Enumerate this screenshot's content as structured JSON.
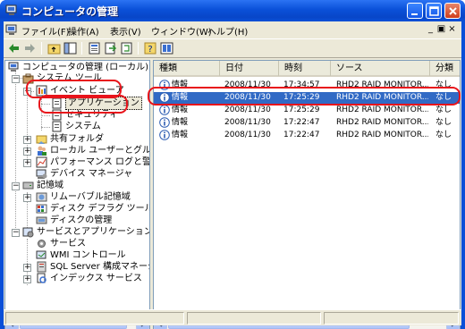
{
  "window": {
    "title": "コンピュータの管理",
    "accent": "#0a4fd8",
    "selection_color": "#316ac5",
    "highlight_color": "#e8141b"
  },
  "menu": [
    "ファイル(F)",
    "操作(A)",
    "表示(V)",
    "ウィンドウ(W)",
    "ヘルプ(H)"
  ],
  "toolbar": [
    "back-icon",
    "forward-icon",
    "up-folder-icon",
    "show-hide-tree-icon",
    "properties-icon",
    "export-icon",
    "refresh-icon",
    "help-icon",
    "tile-icon"
  ],
  "tree": {
    "root": "コンピュータの管理 (ローカル)",
    "system_tools": "システム ツール",
    "event_viewer": "イベント ビューア",
    "application": "アプリケーション",
    "security": "セキュリティ",
    "system": "システム",
    "shared_folders": "共有フォルダ",
    "local_users": "ローカル ユーザーとグループ",
    "performance": "パフォーマンス ログと警告",
    "device_manager": "デバイス マネージャ",
    "storage": "記憶域",
    "removable": "リムーバブル記憶域",
    "defrag": "ディスク デフラグ ツール",
    "disk_mgmt": "ディスクの管理",
    "services_apps": "サービスとアプリケーション",
    "services": "サービス",
    "wmi": "WMI コントロール",
    "sql": "SQL Server 構成マネージャ",
    "indexing": "インデックス サービス"
  },
  "list": {
    "columns": [
      "種類",
      "日付",
      "時刻",
      "ソース",
      "分類"
    ],
    "rows": [
      {
        "type": "情報",
        "date": "2008/11/30",
        "time": "17:34:57",
        "source": "RHD2 RAID MONITOR...",
        "category": "なし"
      },
      {
        "type": "情報",
        "date": "2008/11/30",
        "time": "17:25:29",
        "source": "RHD2 RAID MONITOR...",
        "category": "なし"
      },
      {
        "type": "情報",
        "date": "2008/11/30",
        "time": "17:25:29",
        "source": "RHD2 RAID MONITOR...",
        "category": "なし"
      },
      {
        "type": "情報",
        "date": "2008/11/30",
        "time": "17:22:47",
        "source": "RHD2 RAID MONITOR...",
        "category": "なし"
      },
      {
        "type": "情報",
        "date": "2008/11/30",
        "time": "17:22:47",
        "source": "RHD2 RAID MONITOR...",
        "category": "なし"
      }
    ]
  }
}
